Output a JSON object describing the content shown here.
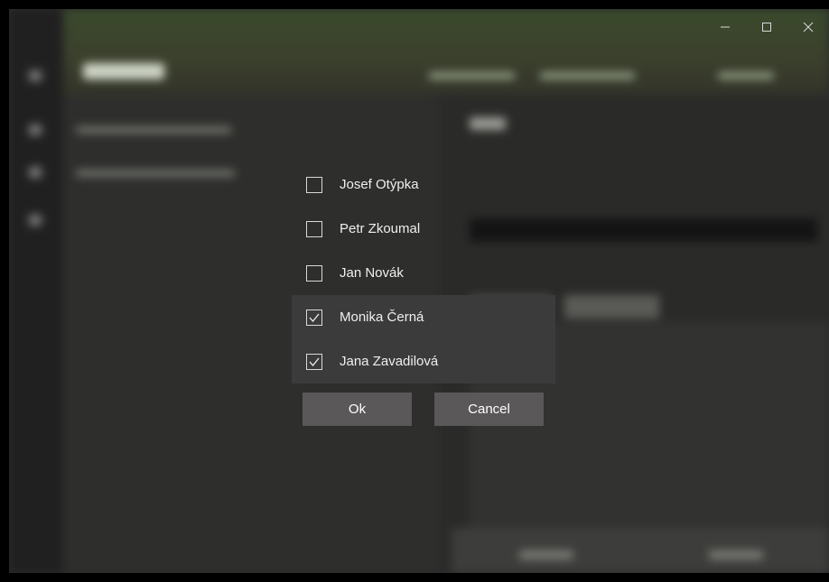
{
  "window": {
    "controls": {
      "minimize_icon": "minimize-icon",
      "maximize_icon": "maximize-icon",
      "close_icon": "close-icon"
    }
  },
  "checklist": {
    "options": [
      {
        "label": "Josef Otýpka",
        "checked": false
      },
      {
        "label": "Petr Zkoumal",
        "checked": false
      },
      {
        "label": "Jan Novák",
        "checked": false
      },
      {
        "label": "Monika Černá",
        "checked": true
      },
      {
        "label": "Jana Zavadilová",
        "checked": true
      }
    ]
  },
  "actions": {
    "ok_label": "Ok",
    "cancel_label": "Cancel"
  },
  "colors": {
    "window_bg": "#2b2b2b",
    "header_tint": "#3a4a2c",
    "selected_row": "#3b3b3b",
    "button_bg": "#5a5858",
    "text": "#efefef"
  }
}
